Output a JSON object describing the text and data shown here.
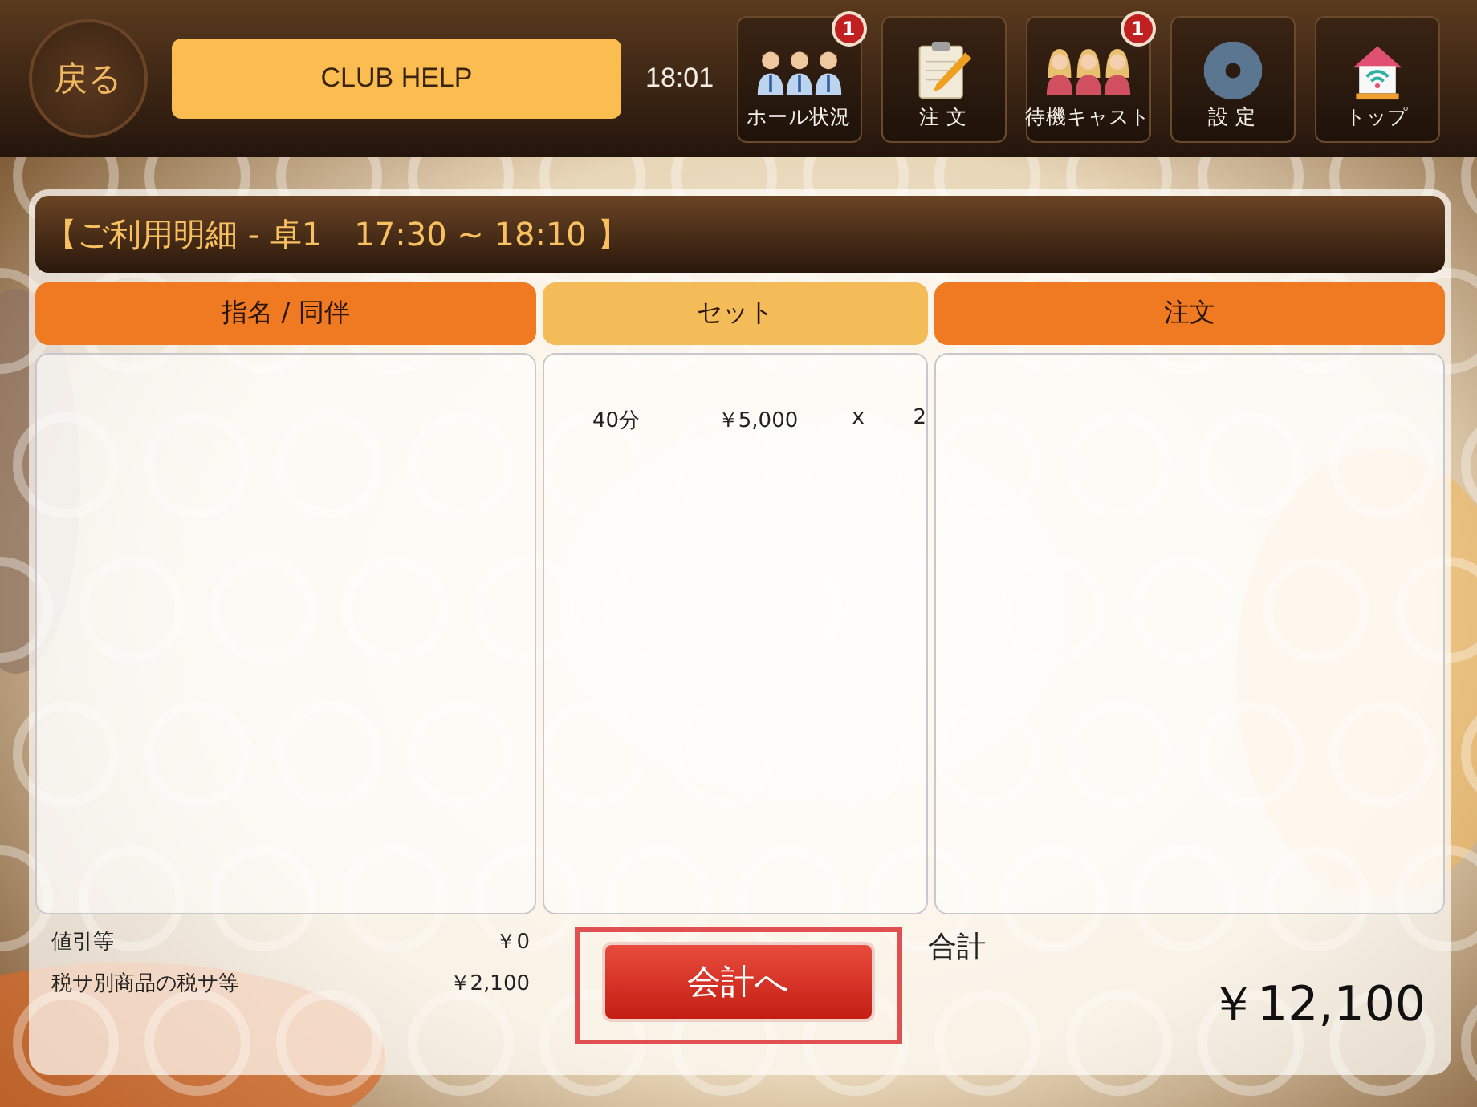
{
  "top_bar": {
    "back_button": "戻る",
    "title": "CLUB HELP",
    "time": "18:01",
    "nav_buttons": [
      {
        "kind": "hall",
        "label": "ホール状況",
        "badge": "1"
      },
      {
        "kind": "order",
        "label": "注 文"
      },
      {
        "kind": "cast",
        "label": "待機キャスト",
        "badge": "1"
      },
      {
        "kind": "settings",
        "label": "設 定"
      },
      {
        "kind": "home",
        "label": "トップ"
      }
    ]
  },
  "detail": {
    "title": "【ご利用明細 - 卓1　17:30 ~ 18:10 】",
    "columns": [
      {
        "heading": "指名 / 同伴",
        "selected": false
      },
      {
        "heading": "セット",
        "selected": true,
        "rows": [
          {
            "item": "40分",
            "price": "￥5,000",
            "times": "x",
            "qty": "2"
          }
        ]
      },
      {
        "heading": "注文",
        "selected": false
      }
    ],
    "adjustments": [
      {
        "label": "値引等",
        "value": "￥0"
      },
      {
        "label": "税サ別商品の税サ等",
        "value": "￥2,100"
      }
    ],
    "checkout_button": {
      "label": "会計へ",
      "highlighted": true
    },
    "total": {
      "label": "合計",
      "value": "￥12,100"
    }
  }
}
